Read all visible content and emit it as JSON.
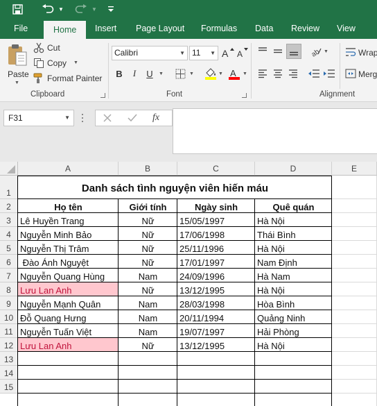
{
  "ribbon_tabs": [
    "File",
    "Home",
    "Insert",
    "Page Layout",
    "Formulas",
    "Data",
    "Review",
    "View"
  ],
  "clipboard": {
    "paste": "Paste",
    "cut": "Cut",
    "copy": "Copy",
    "format_painter": "Format Painter",
    "group_label": "Clipboard"
  },
  "font": {
    "name": "Calibri",
    "size": "11",
    "bold": "B",
    "italic": "I",
    "underline": "U",
    "fill_color": "#ffff00",
    "font_color": "#ff0000",
    "group_label": "Font"
  },
  "alignment": {
    "wrap": "Wrap",
    "merge": "Merg",
    "group_label": "Alignment"
  },
  "formula_bar": {
    "name_box": "F31",
    "fx": "fx",
    "content": ""
  },
  "columns": [
    "A",
    "B",
    "C",
    "D",
    "E"
  ],
  "rows": [
    "1",
    "2",
    "3",
    "4",
    "5",
    "6",
    "7",
    "8",
    "9",
    "10",
    "11",
    "12",
    "13",
    "14",
    "15"
  ],
  "sheet": {
    "title": "Danh sách tình nguyện viên hiến máu",
    "headers": [
      "Họ tên",
      "Giới tính",
      "Ngày sinh",
      "Quê quán"
    ],
    "records": [
      {
        "name": "Lê Huyền Trang",
        "gender": "Nữ",
        "dob": "15/05/1997",
        "hometown": "Hà Nội",
        "highlight": false
      },
      {
        "name": "Nguyễn Minh Bảo",
        "gender": "Nữ",
        "dob": "17/06/1998",
        "hometown": "Thái Bình",
        "highlight": false
      },
      {
        "name": "Nguyễn Thị Trâm",
        "gender": "Nữ",
        "dob": "25/11/1996",
        "hometown": "Hà Nội",
        "highlight": false
      },
      {
        "name": " Đào Ánh Nguyệt",
        "gender": "Nữ",
        "dob": "17/01/1997",
        "hometown": "Nam Định",
        "highlight": false
      },
      {
        "name": "Nguyễn Quang Hùng",
        "gender": "Nam",
        "dob": "24/09/1996",
        "hometown": "Hà Nam",
        "highlight": false
      },
      {
        "name": "Lưu Lan Anh",
        "gender": "Nữ",
        "dob": "13/12/1995",
        "hometown": "Hà Nội",
        "highlight": true
      },
      {
        "name": "Nguyễn Mạnh Quân",
        "gender": "Nam",
        "dob": "28/03/1998",
        "hometown": "Hòa Bình",
        "highlight": false
      },
      {
        "name": "Đỗ Quang Hưng",
        "gender": "Nam",
        "dob": "20/11/1994",
        "hometown": "Quảng Ninh",
        "highlight": false
      },
      {
        "name": "Nguyễn Tuấn Việt",
        "gender": "Nam",
        "dob": "19/07/1997",
        "hometown": "Hải Phòng",
        "highlight": false
      },
      {
        "name": "Lưu Lan Anh",
        "gender": "Nữ",
        "dob": "13/12/1995",
        "hometown": "Hà Nội",
        "highlight": true
      }
    ],
    "highlight_fill": "#ffc7ce",
    "highlight_text": "#c0143c"
  },
  "colors": {
    "accent": "#217346",
    "ribbon_bg": "#f3f3f3"
  }
}
